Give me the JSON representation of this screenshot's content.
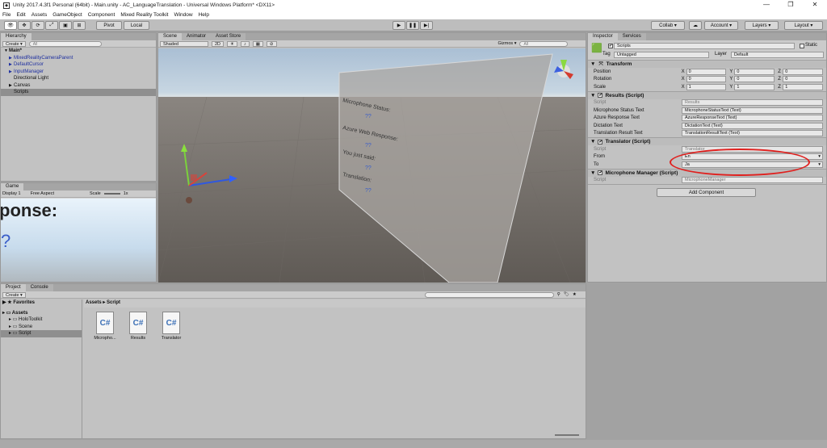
{
  "window": {
    "title": "Unity 2017.4.3f1 Personal (64bit) - Main.unity - AC_LanguageTranslation - Universal Windows Platform* <DX11>",
    "min": "—",
    "max": "❐",
    "close": "✕"
  },
  "menu": [
    "File",
    "Edit",
    "Assets",
    "GameObject",
    "Component",
    "Mixed Reality Toolkit",
    "Window",
    "Help"
  ],
  "toolbar": {
    "pivot": "Pivot",
    "local": "Local",
    "collab": "Collab ▾",
    "account": "Account ▾",
    "layers": "Layers ▾",
    "layout": "Layout ▾"
  },
  "hierarchy": {
    "tab": "Hierarchy",
    "create": "Create ▾",
    "search": "All",
    "items": [
      {
        "label": "Main*",
        "blue": false,
        "bold": true,
        "indent": 0,
        "arrow": "▼"
      },
      {
        "label": "MixedRealityCameraParent",
        "blue": true,
        "bold": false,
        "indent": 1,
        "arrow": "▶"
      },
      {
        "label": "DefaultCursor",
        "blue": true,
        "bold": false,
        "indent": 1,
        "arrow": "▶"
      },
      {
        "label": "InputManager",
        "blue": true,
        "bold": false,
        "indent": 1,
        "arrow": "▶"
      },
      {
        "label": "Directional Light",
        "blue": false,
        "bold": false,
        "indent": 1,
        "arrow": ""
      },
      {
        "label": "Canvas",
        "blue": false,
        "bold": false,
        "indent": 1,
        "arrow": "▶"
      },
      {
        "label": "Scripts",
        "blue": false,
        "bold": false,
        "indent": 1,
        "arrow": "",
        "selected": true
      }
    ]
  },
  "game": {
    "tab": "Game",
    "display": "Display 1",
    "aspect": "Free Aspect",
    "scale_label": "Scale",
    "scale_value": "1x",
    "preview_text1": "ponse:",
    "preview_text2": "?"
  },
  "scene": {
    "tabs": [
      "Scene",
      "Animator",
      "Asset Store"
    ],
    "shaded": "Shaded",
    "mode2d": "2D",
    "gizmos": "Gizmos ▾",
    "search": "All",
    "canvas_lines": [
      "Microphone Status:",
      "??",
      "Azure Web Response:",
      "??",
      "You just said:",
      "??",
      "Translation:",
      "??"
    ]
  },
  "inspector": {
    "tabs": [
      "Inspector",
      "Services"
    ],
    "object_name": "Scripts",
    "static_label": "Static",
    "tag_label": "Tag",
    "tag_value": "Untagged",
    "layer_label": "Layer",
    "layer_value": "Default",
    "transform": {
      "title": "Transform",
      "rows": [
        {
          "label": "Position",
          "x": "0",
          "y": "0",
          "z": "0"
        },
        {
          "label": "Rotation",
          "x": "0",
          "y": "0",
          "z": "0"
        },
        {
          "label": "Scale",
          "x": "1",
          "y": "1",
          "z": "1"
        }
      ]
    },
    "results": {
      "title": "Results (Script)",
      "rows": [
        {
          "label": "Script",
          "value": "Results",
          "disabled": true
        },
        {
          "label": "Microphone Status Text",
          "value": "MicrophoneStatusText (Text)"
        },
        {
          "label": "Azure Response Text",
          "value": "AzureResponseText (Text)"
        },
        {
          "label": "Dictation Text",
          "value": "DictationText (Text)"
        },
        {
          "label": "Translation Result Text",
          "value": "TranslationResultText (Text)"
        }
      ]
    },
    "translator": {
      "title": "Translator (Script)",
      "script_label": "Script",
      "script_value": "Translator",
      "from_label": "From",
      "from_value": "En",
      "to_label": "To",
      "to_value": "Ja"
    },
    "microphone": {
      "title": "Microphone Manager (Script)",
      "script_label": "Script",
      "script_value": "MicrophoneManager"
    },
    "add_component": "Add Component"
  },
  "project": {
    "tabs": [
      "Project",
      "Console"
    ],
    "create": "Create ▾",
    "breadcrumb": "Assets ▸ Script",
    "favorites": "Favorites",
    "tree": [
      {
        "label": "Assets",
        "bold": true,
        "indent": 0
      },
      {
        "label": "HoloToolkit",
        "bold": false,
        "indent": 1
      },
      {
        "label": "Scene",
        "bold": false,
        "indent": 1
      },
      {
        "label": "Script",
        "bold": false,
        "indent": 1,
        "selected": true
      }
    ],
    "assets": [
      "Micropho...",
      "Results",
      "Translator"
    ]
  },
  "colors": {
    "highlight": "#e0201e",
    "selection": "#8f8f8f"
  }
}
